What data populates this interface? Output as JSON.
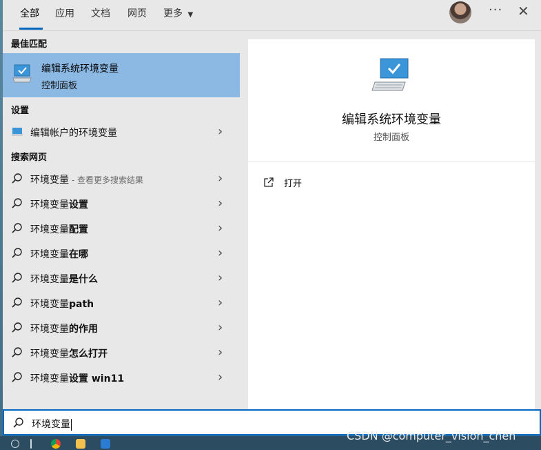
{
  "tabs": [
    {
      "label": "全部",
      "active": true
    },
    {
      "label": "应用",
      "active": false
    },
    {
      "label": "文档",
      "active": false
    },
    {
      "label": "网页",
      "active": false
    },
    {
      "label": "更多",
      "active": false
    }
  ],
  "sections": {
    "best_match": "最佳匹配",
    "settings": "设置",
    "web": "搜索网页"
  },
  "best_match": {
    "title": "编辑系统环境变量",
    "subtitle": "控制面板"
  },
  "settings_item": {
    "label": "编辑帐户的环境变量"
  },
  "web_results": [
    {
      "prefix": "环境变量",
      "bold": "",
      "hint": " - 查看更多搜索结果"
    },
    {
      "prefix": "环境变量",
      "bold": "设置",
      "hint": ""
    },
    {
      "prefix": "环境变量",
      "bold": "配置",
      "hint": ""
    },
    {
      "prefix": "环境变量",
      "bold": "在哪",
      "hint": ""
    },
    {
      "prefix": "环境变量",
      "bold": "是什么",
      "hint": ""
    },
    {
      "prefix": "环境变量",
      "bold": "path",
      "hint": ""
    },
    {
      "prefix": "环境变量",
      "bold": "的作用",
      "hint": ""
    },
    {
      "prefix": "环境变量",
      "bold": "怎么打开",
      "hint": ""
    },
    {
      "prefix": "环境变量",
      "bold": "设置 win11",
      "hint": ""
    }
  ],
  "detail": {
    "title": "编辑系统环境变量",
    "subtitle": "控制面板",
    "open_label": "打开"
  },
  "search": {
    "value": "环境变量"
  },
  "watermark": "CSDN @computer_vision_chen",
  "colors": {
    "accent": "#0067c0",
    "selected": "#8bb9e3"
  }
}
